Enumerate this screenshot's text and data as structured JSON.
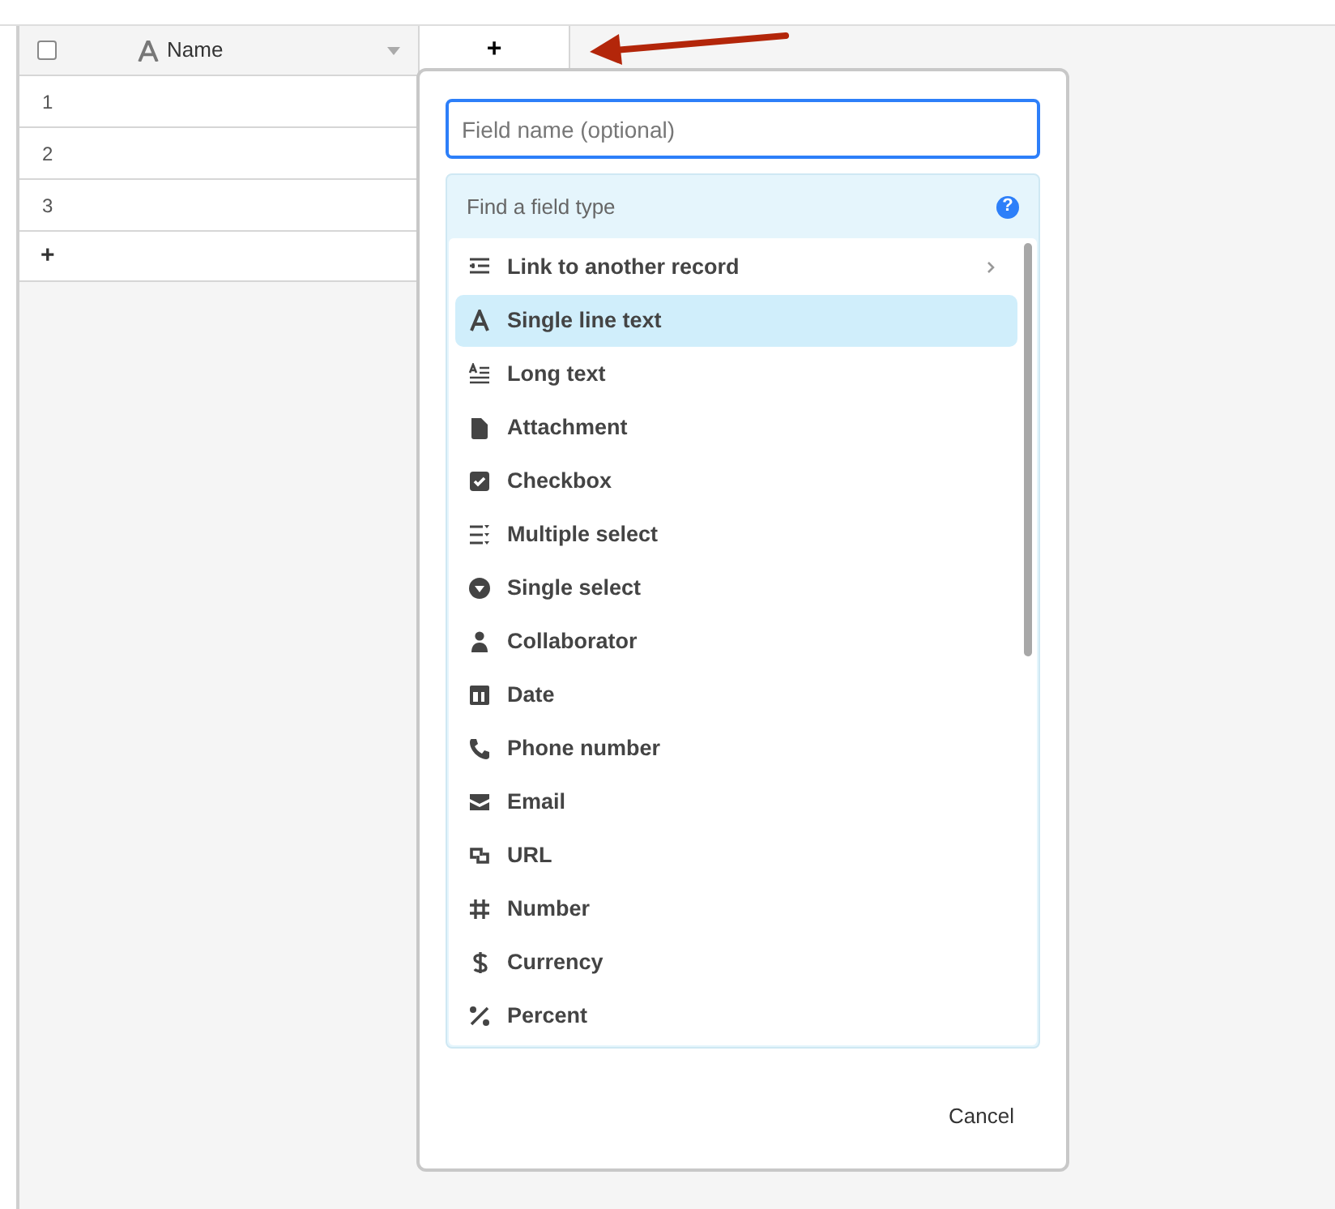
{
  "grid": {
    "select_all": {
      "checked": false
    },
    "columns": [
      {
        "label": "Name"
      }
    ],
    "add_column": "+",
    "rows": [
      {
        "number": "1"
      },
      {
        "number": "2"
      },
      {
        "number": "3"
      }
    ],
    "add_row": "+"
  },
  "field_popup": {
    "name_field": {
      "placeholder": "Field name (optional)"
    },
    "type_search": {
      "placeholder": "Find a field type",
      "help": "?"
    },
    "field_types": [
      {
        "label": "Link to another record",
        "kind": "link",
        "selected": false,
        "submenu": true
      },
      {
        "label": "Single line text",
        "kind": "text",
        "selected": true,
        "submenu": false
      },
      {
        "label": "Long text",
        "kind": "longtext",
        "selected": false,
        "submenu": false
      },
      {
        "label": "Attachment",
        "kind": "attachment",
        "selected": false,
        "submenu": false
      },
      {
        "label": "Checkbox",
        "kind": "checkbox",
        "selected": false,
        "submenu": false
      },
      {
        "label": "Multiple select",
        "kind": "multiselect",
        "selected": false,
        "submenu": false
      },
      {
        "label": "Single select",
        "kind": "singleselect",
        "selected": false,
        "submenu": false
      },
      {
        "label": "Collaborator",
        "kind": "person",
        "selected": false,
        "submenu": false
      },
      {
        "label": "Date",
        "kind": "date",
        "selected": false,
        "submenu": false
      },
      {
        "label": "Phone number",
        "kind": "phone",
        "selected": false,
        "submenu": false
      },
      {
        "label": "Email",
        "kind": "email",
        "selected": false,
        "submenu": false
      },
      {
        "label": "URL",
        "kind": "url",
        "selected": false,
        "submenu": false
      },
      {
        "label": "Number",
        "kind": "number",
        "selected": false,
        "submenu": false
      },
      {
        "label": "Currency",
        "kind": "currency",
        "selected": false,
        "submenu": false
      },
      {
        "label": "Percent",
        "kind": "percent",
        "selected": false,
        "submenu": false
      }
    ],
    "cancel": "Cancel"
  }
}
